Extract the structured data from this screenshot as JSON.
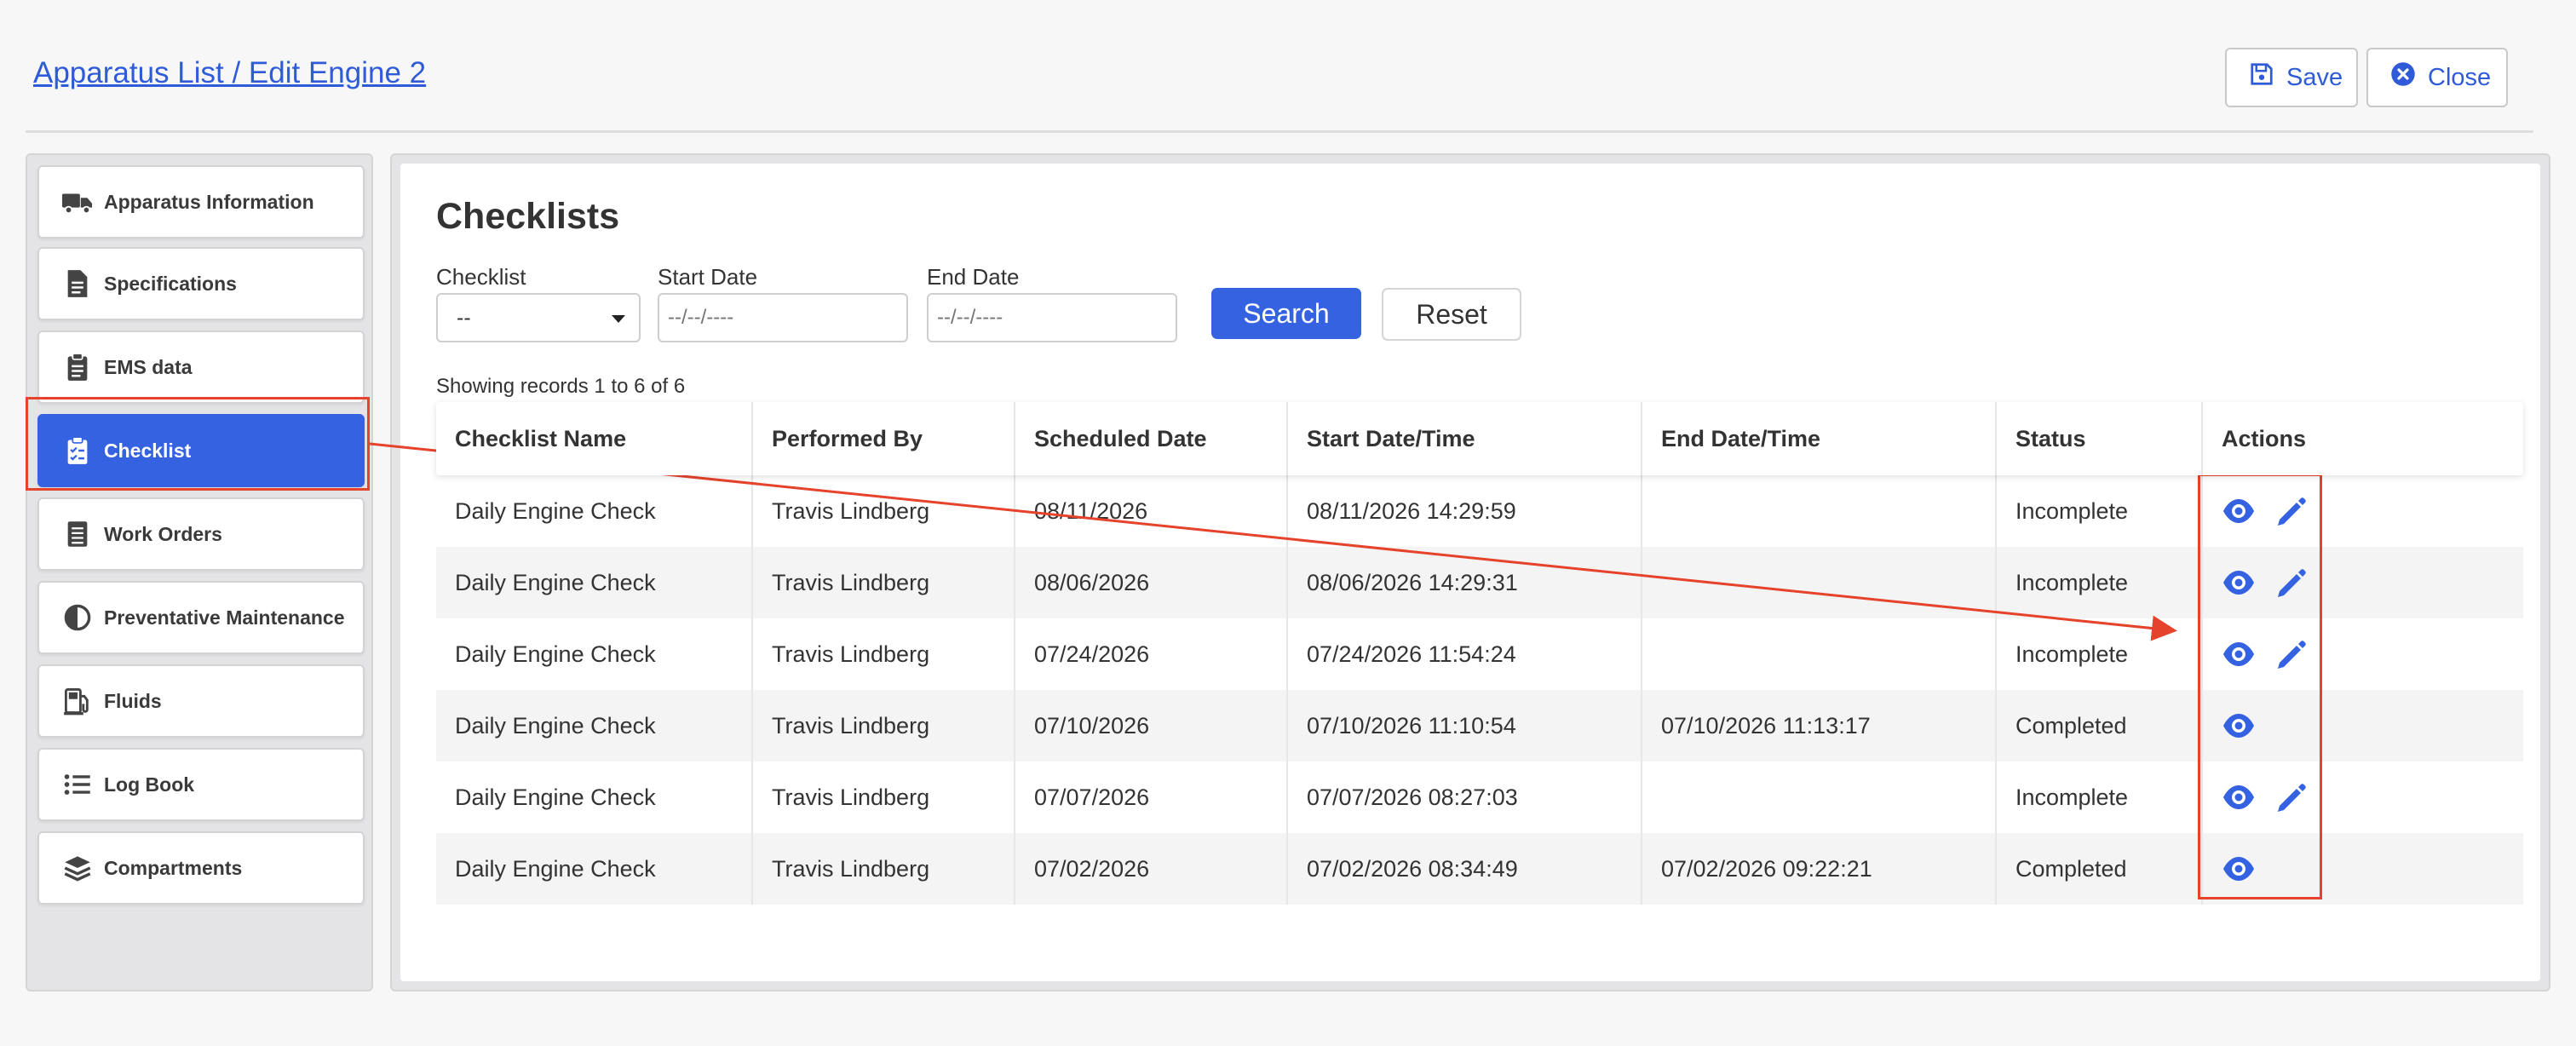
{
  "header": {
    "breadcrumb": "Apparatus List / Edit Engine 2",
    "save_label": "Save",
    "close_label": "Close"
  },
  "sidebar": {
    "items": [
      {
        "label": "Apparatus Information",
        "icon": "truck-icon"
      },
      {
        "label": "Specifications",
        "icon": "document-icon"
      },
      {
        "label": "EMS data",
        "icon": "clipboard-icon"
      },
      {
        "label": "Checklist",
        "icon": "checklist-icon",
        "active": true
      },
      {
        "label": "Work Orders",
        "icon": "list-document-icon"
      },
      {
        "label": "Preventative Maintenance",
        "icon": "half-circle-icon"
      },
      {
        "label": "Fluids",
        "icon": "fuel-pump-icon"
      },
      {
        "label": "Log Book",
        "icon": "list-icon"
      },
      {
        "label": "Compartments",
        "icon": "layers-icon"
      }
    ]
  },
  "main": {
    "title": "Checklists",
    "filters": {
      "checklist_label": "Checklist",
      "checklist_value": "--",
      "start_label": "Start Date",
      "start_placeholder": "--/--/----",
      "end_label": "End Date",
      "end_placeholder": "--/--/----",
      "search_label": "Search",
      "reset_label": "Reset"
    },
    "records_text": "Showing records 1 to 6 of 6",
    "columns": [
      "Checklist Name",
      "Performed By",
      "Scheduled Date",
      "Start Date/Time",
      "End Date/Time",
      "Status",
      "Actions"
    ],
    "rows": [
      {
        "name": "Daily Engine Check",
        "by": "Travis Lindberg",
        "scheduled": "08/11/2026",
        "start": "08/11/2026 14:29:59",
        "end": "",
        "status": "Incomplete",
        "editable": true
      },
      {
        "name": "Daily Engine Check",
        "by": "Travis Lindberg",
        "scheduled": "08/06/2026",
        "start": "08/06/2026 14:29:31",
        "end": "",
        "status": "Incomplete",
        "editable": true
      },
      {
        "name": "Daily Engine Check",
        "by": "Travis Lindberg",
        "scheduled": "07/24/2026",
        "start": "07/24/2026 11:54:24",
        "end": "",
        "status": "Incomplete",
        "editable": true
      },
      {
        "name": "Daily Engine Check",
        "by": "Travis Lindberg",
        "scheduled": "07/10/2026",
        "start": "07/10/2026 11:10:54",
        "end": "07/10/2026 11:13:17",
        "status": "Completed",
        "editable": false
      },
      {
        "name": "Daily Engine Check",
        "by": "Travis Lindberg",
        "scheduled": "07/07/2026",
        "start": "07/07/2026 08:27:03",
        "end": "",
        "status": "Incomplete",
        "editable": true
      },
      {
        "name": "Daily Engine Check",
        "by": "Travis Lindberg",
        "scheduled": "07/02/2026",
        "start": "07/02/2026 08:34:49",
        "end": "07/02/2026 09:22:21",
        "status": "Completed",
        "editable": false
      }
    ]
  },
  "colors": {
    "accent": "#3562e0",
    "link": "#2f5bd8",
    "annotation": "#e5432b"
  }
}
